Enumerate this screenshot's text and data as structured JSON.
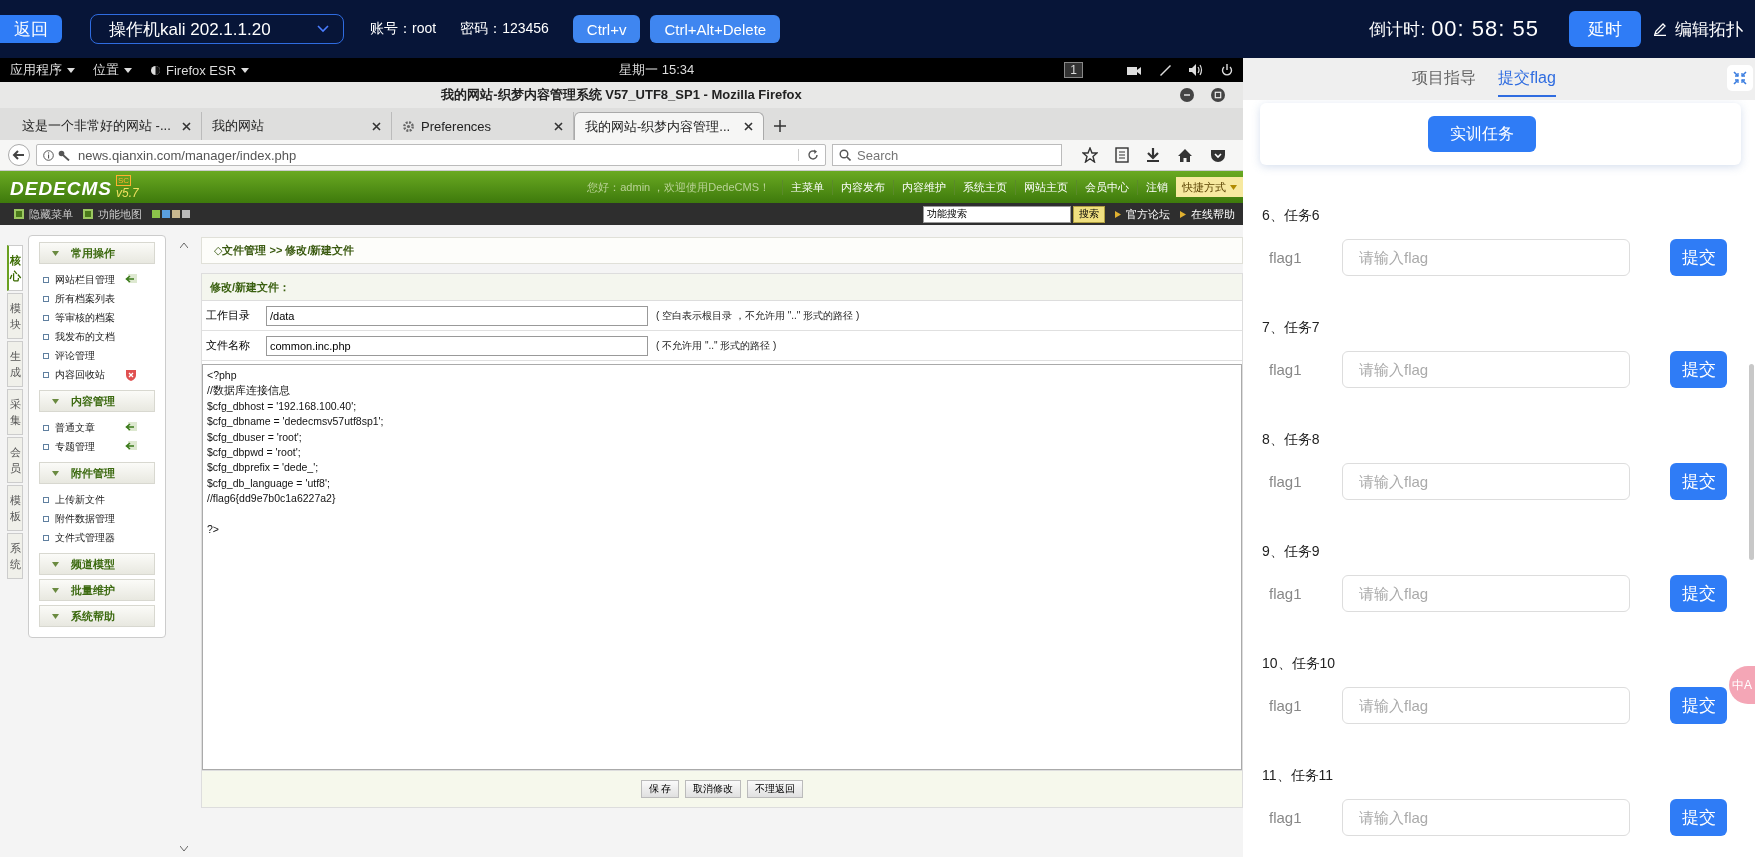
{
  "top_bar": {
    "back": "返回",
    "machine_select": {
      "value": "操作机kali 202.1.1.20"
    },
    "account": "账号：root",
    "password": "密码：123456",
    "keys": [
      "Ctrl+v",
      "Ctrl+Alt+Delete"
    ],
    "countdown_label": "倒计时:",
    "countdown": "00: 58: 55",
    "extend": "延时",
    "edit_topology": "编辑拓扑"
  },
  "desktop_bar": {
    "menus": [
      "应用程序",
      "位置",
      "Firefox ESR"
    ],
    "clock": "星期一 15:34",
    "workspace": "1"
  },
  "browser": {
    "title": "我的网站-织梦内容管理系统 V57_UTF8_SP1 - Mozilla Firefox",
    "tabs": [
      {
        "label": "这是一个非常好的网站 -...",
        "kind": "page",
        "selected": false
      },
      {
        "label": "我的网站",
        "kind": "page",
        "selected": false
      },
      {
        "label": "Preferences",
        "kind": "settings",
        "selected": false
      },
      {
        "label": "我的网站-织梦内容管理...",
        "kind": "page",
        "selected": true
      }
    ],
    "url": "news.qianxin.com/manager/index.php",
    "search": {
      "placeholder": "Search"
    }
  },
  "cms": {
    "logo": "DEDECMS",
    "version": "v5.7",
    "edition": "SC",
    "greeting": "您好：admin ，欢迎使用DedeCMS！",
    "nav": [
      "主菜单",
      "内容发布",
      "内容维护",
      "系统主页",
      "网站主页",
      "会员中心",
      "注销"
    ],
    "quick_menu": "快捷方式",
    "tools": [
      "隐藏菜单",
      "功能地图"
    ],
    "search_value": "功能搜索",
    "search_button": "搜索",
    "links": [
      "官方论坛",
      "在线帮助"
    ],
    "side_tabs": [
      {
        "label": "核心",
        "selected": true
      },
      {
        "label": "模块",
        "selected": false
      },
      {
        "label": "生成",
        "selected": false
      },
      {
        "label": "采集",
        "selected": false
      },
      {
        "label": "会员",
        "selected": false
      },
      {
        "label": "模板",
        "selected": false
      },
      {
        "label": "系统",
        "selected": false
      }
    ],
    "menu": [
      {
        "title": "常用操作",
        "items": [
          {
            "label": "网站栏目管理",
            "kind": "add"
          },
          {
            "label": "所有档案列表"
          },
          {
            "label": "等审核的档案"
          },
          {
            "label": "我发布的文档"
          },
          {
            "label": "评论管理"
          },
          {
            "label": "内容回收站",
            "kind": "recycle"
          }
        ]
      },
      {
        "title": "内容管理",
        "items": [
          {
            "label": "普通文章",
            "kind": "add"
          },
          {
            "label": "专题管理",
            "kind": "add"
          }
        ]
      },
      {
        "title": "附件管理",
        "items": [
          {
            "label": "上传新文件"
          },
          {
            "label": "附件数据管理"
          },
          {
            "label": "文件式管理器"
          }
        ]
      },
      {
        "title": "频道模型"
      },
      {
        "title": "批量维护"
      },
      {
        "title": "系统帮助"
      }
    ],
    "breadcrumb": "◇文件管理 >> 修改/新建文件",
    "form_title": "修改/新建文件：",
    "fields": [
      {
        "label": "工作目录",
        "value": "/data",
        "hint": "( 空白表示根目录 ，不允许用 \"..\" 形式的路径 )"
      },
      {
        "label": "文件名称",
        "value": "common.inc.php",
        "hint": "( 不允许用 \"..\" 形式的路径 )"
      }
    ],
    "code": "<?php\n//数据库连接信息\n$cfg_dbhost = '192.168.100.40';\n$cfg_dbname = 'dedecmsv57utf8sp1';\n$cfg_dbuser = 'root';\n$cfg_dbpwd = 'root';\n$cfg_dbprefix = 'dede_';\n$cfg_db_language = 'utf8';\n//flag6{dd9e7b0c1a6227a2}\n\n?>",
    "buttons": [
      "保 存",
      "取消修改",
      "不理返回"
    ]
  },
  "panel": {
    "tabs": [
      {
        "label": "项目指导",
        "selected": false
      },
      {
        "label": "提交flag",
        "selected": true
      }
    ],
    "task_button": "实训任务",
    "tasks": [
      {
        "title": "6、任务6",
        "flag_label": "flag1",
        "placeholder": "请输入flag",
        "submit": "提交"
      },
      {
        "title": "7、任务7",
        "flag_label": "flag1",
        "placeholder": "请输入flag",
        "submit": "提交"
      },
      {
        "title": "8、任务8",
        "flag_label": "flag1",
        "placeholder": "请输入flag",
        "submit": "提交"
      },
      {
        "title": "9、任务9",
        "flag_label": "flag1",
        "placeholder": "请输入flag",
        "submit": "提交"
      },
      {
        "title": "10、任务10",
        "flag_label": "flag1",
        "placeholder": "请输入flag",
        "submit": "提交"
      },
      {
        "title": "11、任务11",
        "flag_label": "flag1",
        "placeholder": "请输入flag",
        "submit": "提交"
      }
    ],
    "translate_badge": "中A"
  }
}
